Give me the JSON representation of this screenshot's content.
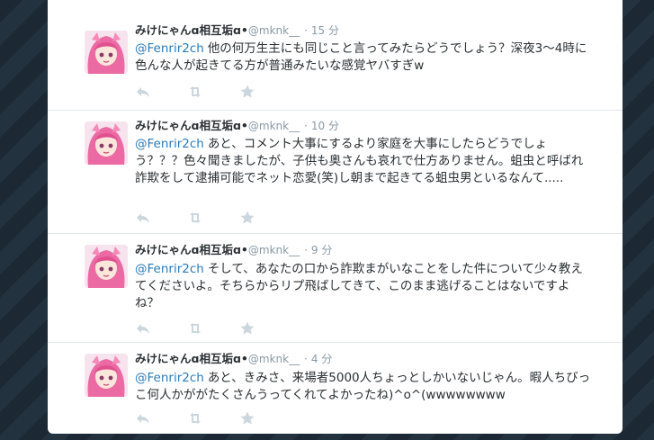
{
  "tweets": [
    {
      "name": "みけにゃんɑ相互垢ɑ•",
      "handle": "@mknk__",
      "time": "15 分",
      "mention": "@Fenrir2ch",
      "text": "他の何万生主にも同じこと言ってみたらどうでしょう？深夜3～4時に色んな人が起きてる方が普通みたいな感覚ヤバすぎw"
    },
    {
      "name": "みけにゃんɑ相互垢ɑ•",
      "handle": "@mknk__",
      "time": "10 分",
      "mention": "@Fenrir2ch",
      "text": "あと、コメント大事にするより家庭を大事にしたらどうでしょう？？？色々聞きましたが、子供も奥さんも哀れで仕方ありません。蛆虫と呼ばれ詐欺をして逮捕可能でネット恋愛(笑)し朝まで起きてる蛆虫男といるなんて....."
    },
    {
      "name": "みけにゃんɑ相互垢ɑ•",
      "handle": "@mknk__",
      "time": "9 分",
      "mention": "@Fenrir2ch",
      "text": "そして、あなたの口から詐欺まがいなことをした件について少々教えてくださいよ。そちらからリプ飛ばしてきて、このまま逃げることはないですよね？"
    },
    {
      "name": "みけにゃんɑ相互垢ɑ•",
      "handle": "@mknk__",
      "time": "4 分",
      "mention": "@Fenrir2ch",
      "text": "あと、きみさ、来場者5000人ちょっとしかいないじゃん。暇人ちびっこ何人かががたくさんうってくれてよかったね)^o^(wwwwwwww"
    }
  ],
  "icons": {
    "reply": "reply-icon",
    "retweet": "retweet-icon",
    "favorite": "star-icon"
  },
  "colors": {
    "link": "#2b7bb9",
    "muted": "#8899a6",
    "action_icon": "#ccd6dd",
    "avatar_hair": "#ec6aa4"
  }
}
